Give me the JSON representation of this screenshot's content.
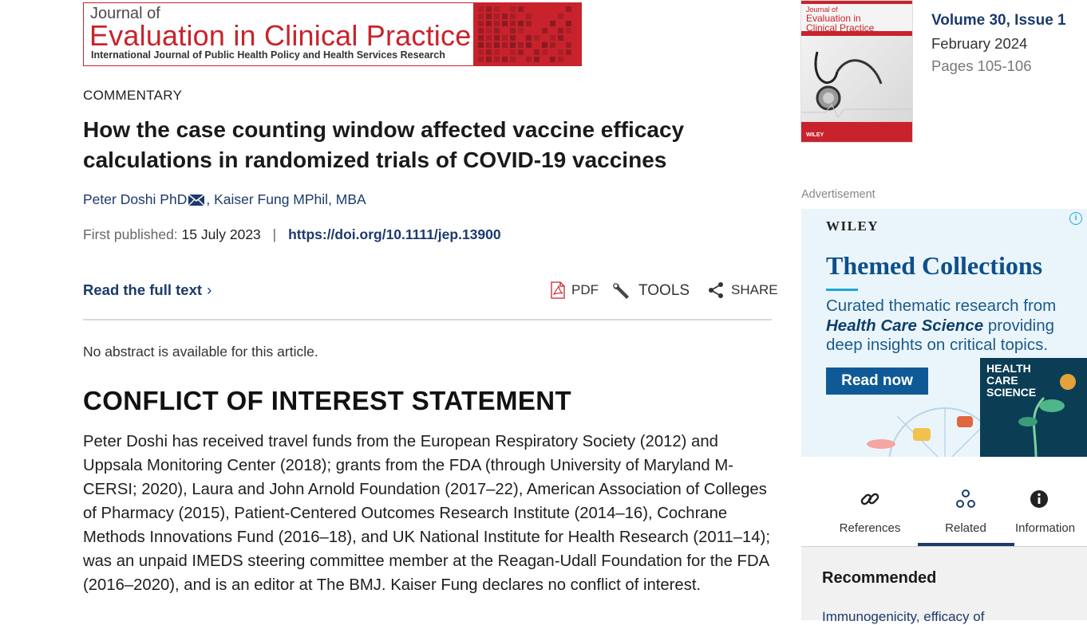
{
  "journal_banner": {
    "line1": "Journal of",
    "line2": "Evaluation in Clinical Practice",
    "line3": "International Journal of Public Health Policy and Health Services Research"
  },
  "article": {
    "type": "COMMENTARY",
    "title": "How the case counting window affected vaccine efficacy calculations in randomized trials of COVID-19 vaccines",
    "author1": "Peter Doshi PhD",
    "author_sep": ",",
    "author2": "Kaiser Fung MPhil, MBA",
    "first_published_label": "First published:",
    "first_published_date": "15 July 2023",
    "separator": "|",
    "doi": "https://doi.org/10.1111/jep.13900"
  },
  "actions": {
    "read_full_text": "Read the full text",
    "pdf": "PDF",
    "tools": "TOOLS",
    "share": "SHARE"
  },
  "abstract_note": "No abstract is available for this article.",
  "conflict": {
    "heading": "CONFLICT OF INTEREST STATEMENT",
    "body": "Peter Doshi has received travel funds from the European Respiratory Society (2012) and Uppsala Monitoring Center (2018); grants from the FDA (through University of Maryland M-CERSI; 2020), Laura and John Arnold Foundation (2017–22), American Association of Colleges of Pharmacy (2015), Patient-Centered Outcomes Research Institute (2014–16), Cochrane Methods Innovations Fund (2016–18), and UK National Institute for Health Research (2011–14); was an unpaid IMEDS steering committee member at the Reagan-Udall Foundation for the FDA (2016–2020), and is an editor at The BMJ. Kaiser Fung declares no conflict of interest."
  },
  "issue": {
    "cover_journal_line1": "Journal of",
    "cover_journal_line2": "Evaluation in Clinical Practice",
    "cover_publisher": "WILEY",
    "volume": "Volume 30, Issue 1",
    "month": "February 2024",
    "pages": "Pages 105-106"
  },
  "advertisement": {
    "label": "Advertisement",
    "brand": "WILEY",
    "headline": "Themed Collections",
    "text_before": "Curated thematic research from ",
    "text_emphasis": "Health Care Science",
    "text_after": " providing deep insights on critical topics.",
    "button": "Read now",
    "journal_badge_l1": "HEALTH",
    "journal_badge_l2": "CARE",
    "journal_badge_l3": "SCIENCE",
    "accent_color": "#0f5a96"
  },
  "tabs": [
    {
      "label": "References",
      "icon": "link-icon"
    },
    {
      "label": "Related",
      "icon": "related-icon",
      "active": true
    },
    {
      "label": "Information",
      "icon": "info-icon"
    }
  ],
  "recommended": {
    "heading": "Recommended",
    "first_item": "Immunogenicity, efficacy of"
  },
  "colors": {
    "link": "#1d3a6b",
    "brand_red": "#c8232c"
  }
}
